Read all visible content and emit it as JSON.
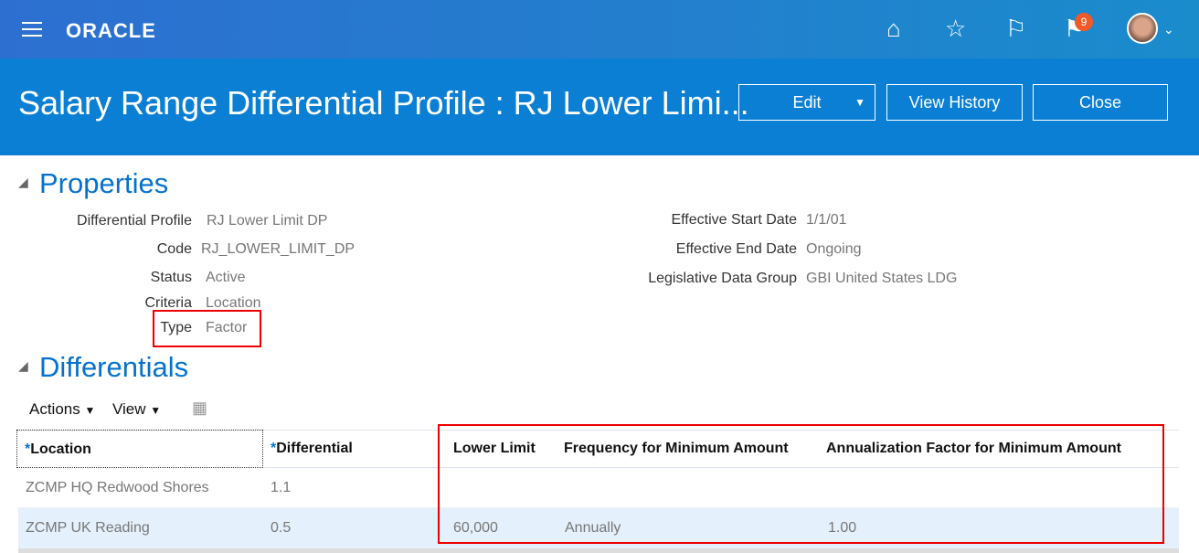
{
  "header": {
    "logo": "ORACLE",
    "notification_count": "9"
  },
  "page": {
    "title": "Salary Range Differential Profile : RJ Lower Limi...",
    "edit": "Edit",
    "view_history": "View History",
    "close": "Close"
  },
  "properties": {
    "heading": "Properties",
    "left": [
      {
        "label": "Differential Profile",
        "value": "RJ Lower Limit DP"
      },
      {
        "label": "Code",
        "value": "RJ_LOWER_LIMIT_DP"
      },
      {
        "label": "Status",
        "value": "Active"
      },
      {
        "label": "Criteria",
        "value": "Location"
      },
      {
        "label": "Type",
        "value": "Factor"
      }
    ],
    "right": [
      {
        "label": "Effective Start Date",
        "value": "1/1/01"
      },
      {
        "label": "Effective End Date",
        "value": "Ongoing"
      },
      {
        "label": "Legislative Data Group",
        "value": "GBI United States LDG"
      }
    ]
  },
  "differentials": {
    "heading": "Differentials",
    "actions": "Actions",
    "view": "View",
    "columns": [
      "Location",
      "Differential",
      "Lower Limit",
      "Frequency for Minimum Amount",
      "Annualization Factor for Minimum Amount"
    ],
    "rows": [
      [
        "ZCMP HQ Redwood Shores",
        "1.1",
        "",
        "",
        ""
      ],
      [
        "ZCMP UK Reading",
        "0.5",
        "60,000",
        "Annually",
        "1.00"
      ]
    ]
  }
}
